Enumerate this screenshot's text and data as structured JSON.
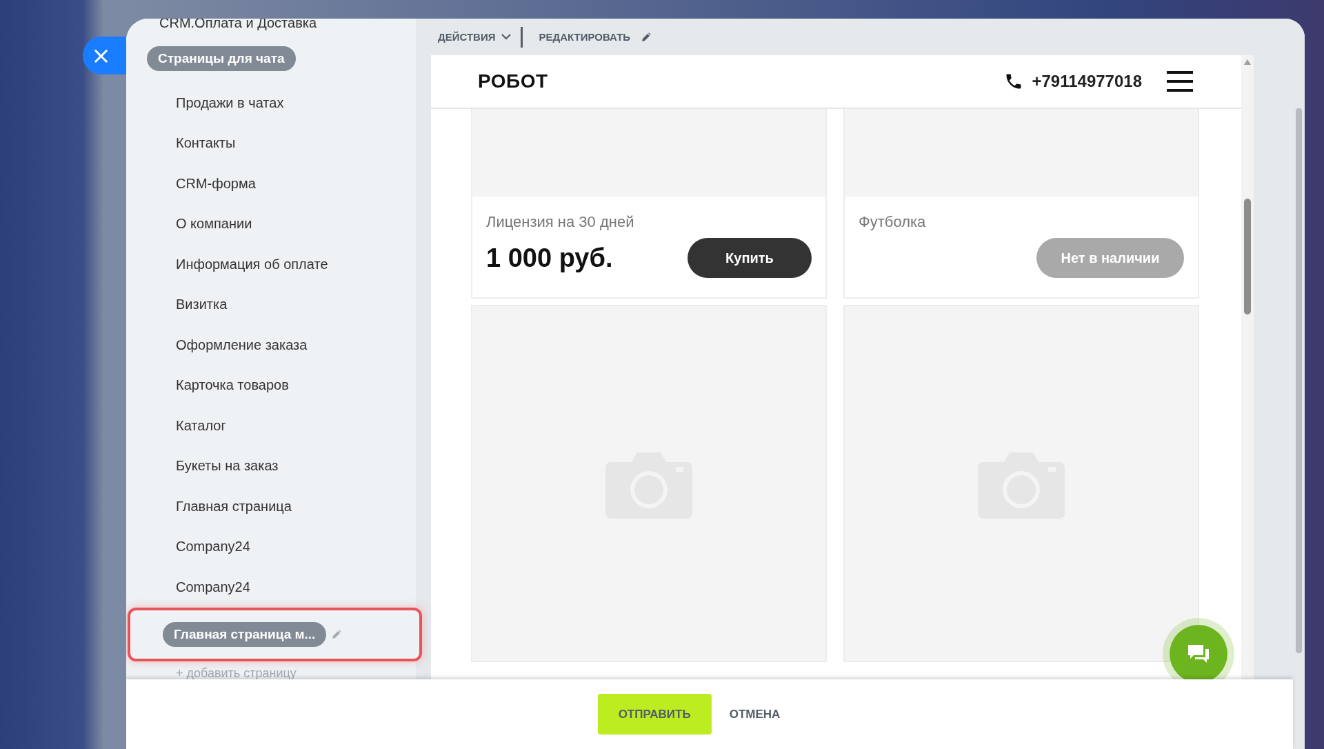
{
  "close_button": {
    "label": "×"
  },
  "sidebar": {
    "section_title": "CRM.Оплата и Доставка",
    "group": {
      "label": "Страницы для чата"
    },
    "items": [
      {
        "label": "Продажи в чатах",
        "selected": false,
        "highlighted": false
      },
      {
        "label": "Контакты",
        "selected": false,
        "highlighted": false
      },
      {
        "label": "CRM-форма",
        "selected": false,
        "highlighted": false
      },
      {
        "label": "О компании",
        "selected": false,
        "highlighted": false
      },
      {
        "label": "Информация об оплате",
        "selected": false,
        "highlighted": false
      },
      {
        "label": "Визитка",
        "selected": false,
        "highlighted": false
      },
      {
        "label": "Оформление заказа",
        "selected": false,
        "highlighted": false
      },
      {
        "label": "Карточка товаров",
        "selected": false,
        "highlighted": false
      },
      {
        "label": "Каталог",
        "selected": false,
        "highlighted": false
      },
      {
        "label": "Букеты на заказ",
        "selected": false,
        "highlighted": false
      },
      {
        "label": "Главная страница",
        "selected": false,
        "highlighted": false
      },
      {
        "label": "Company24",
        "selected": false,
        "highlighted": false
      },
      {
        "label": "Company24",
        "selected": false,
        "highlighted": false
      },
      {
        "label": "Главная страница м...",
        "selected": true,
        "highlighted": true
      }
    ],
    "add_link": "+ добавить страницу"
  },
  "toolbar": {
    "actions": "ДЕЙСТВИЯ",
    "edit": "РЕДАКТИРОВАТЬ"
  },
  "preview": {
    "logo": "РОБОТ",
    "phone": "+79114977018",
    "products": [
      {
        "kind": "product",
        "title": "Лицензия на 30 дней",
        "price": "1 000 руб.",
        "button": {
          "label": "Купить",
          "disabled": false
        }
      },
      {
        "kind": "product",
        "title": "Футболка",
        "button": {
          "label": "Нет в наличии",
          "disabled": true
        }
      },
      {
        "kind": "image_only"
      },
      {
        "kind": "image_only"
      }
    ]
  },
  "footer": {
    "submit": "ОТПРАВИТЬ",
    "cancel": "ОТМЕНА"
  }
}
